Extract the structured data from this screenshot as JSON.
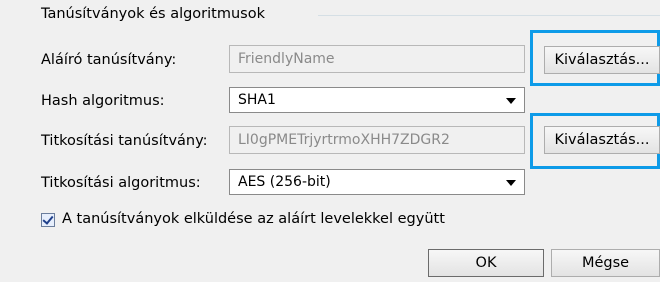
{
  "group": {
    "title": "Tanúsítványok és algoritmusok"
  },
  "signing_cert": {
    "label": "Aláíró tanúsítvány:",
    "value": "FriendlyName",
    "button": "Kiválasztás..."
  },
  "hash_algo": {
    "label": "Hash algoritmus:",
    "value": "SHA1"
  },
  "encryption_cert": {
    "label": "Titkosítási tanúsítvány:",
    "value": "LI0gPMETrjyrtrmoXHH7ZDGR2",
    "button": "Kiválasztás..."
  },
  "encryption_algo": {
    "label": "Titkosítási algoritmus:",
    "value": "AES (256-bit)"
  },
  "send_certs": {
    "label": "A tanúsítványok elküldése az aláírt levelekkel együtt",
    "checked": true
  },
  "footer": {
    "ok": "OK",
    "cancel": "Mégse"
  },
  "colors": {
    "highlight": "#0e9be8",
    "background": "#f0f0f0"
  }
}
